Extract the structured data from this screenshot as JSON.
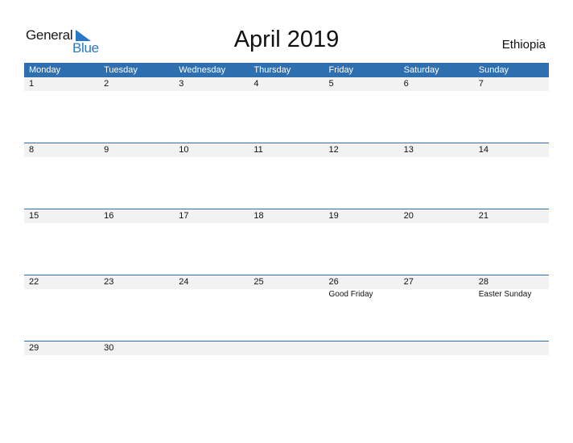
{
  "logo": {
    "part1": "General",
    "part2": "Blue"
  },
  "title": "April 2019",
  "country": "Ethiopia",
  "colors": {
    "header_bg": "#2e6fb0",
    "accent": "#2a78c4",
    "day_strip": "#f2f2f2"
  },
  "weekdays": [
    "Monday",
    "Tuesday",
    "Wednesday",
    "Thursday",
    "Friday",
    "Saturday",
    "Sunday"
  ],
  "weeks": [
    {
      "days": [
        "1",
        "2",
        "3",
        "4",
        "5",
        "6",
        "7"
      ],
      "holidays": [
        "",
        "",
        "",
        "",
        "",
        "",
        ""
      ]
    },
    {
      "days": [
        "8",
        "9",
        "10",
        "11",
        "12",
        "13",
        "14"
      ],
      "holidays": [
        "",
        "",
        "",
        "",
        "",
        "",
        ""
      ]
    },
    {
      "days": [
        "15",
        "16",
        "17",
        "18",
        "19",
        "20",
        "21"
      ],
      "holidays": [
        "",
        "",
        "",
        "",
        "",
        "",
        ""
      ]
    },
    {
      "days": [
        "22",
        "23",
        "24",
        "25",
        "26",
        "27",
        "28"
      ],
      "holidays": [
        "",
        "",
        "",
        "",
        "Good Friday",
        "",
        "Easter Sunday"
      ]
    },
    {
      "days": [
        "29",
        "30",
        "",
        "",
        "",
        "",
        ""
      ],
      "holidays": [
        "",
        "",
        "",
        "",
        "",
        "",
        ""
      ]
    }
  ]
}
